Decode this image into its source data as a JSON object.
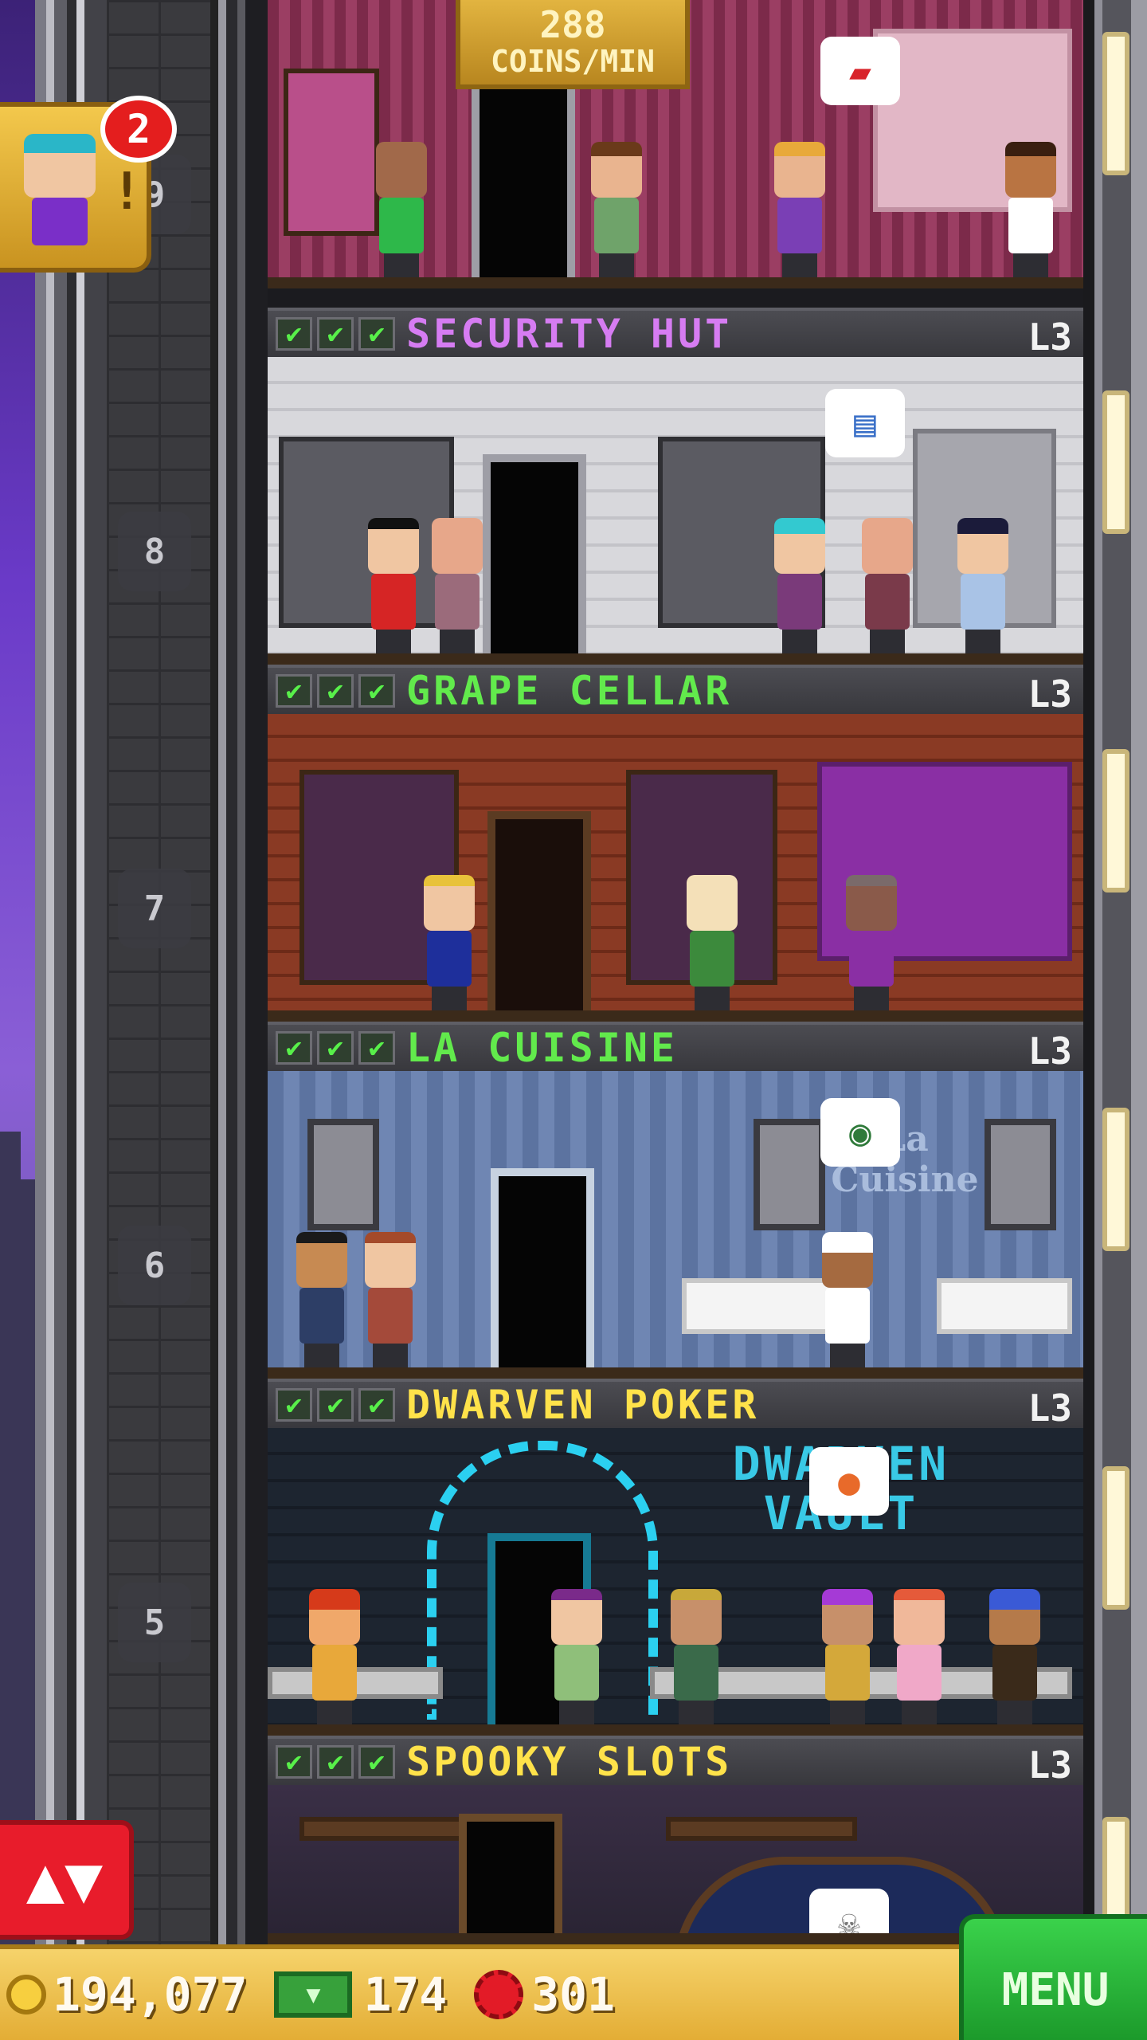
{
  "hud": {
    "coins_per_min_value": "288",
    "coins_per_min_label": "COINS/MIN",
    "coins": "194,077",
    "tower_bux": "174",
    "golden_tickets": "301",
    "menu_label": "MENU",
    "vip_notification_count": "2",
    "vip_alert": "!"
  },
  "elevator": {
    "floor_numbers": [
      "9",
      "8",
      "7",
      "6",
      "5"
    ],
    "button_glyph": "▲▼"
  },
  "floors": [
    {
      "name": "SECURITY HUT",
      "level": "L3",
      "name_color": "#d67cf2",
      "checks": [
        "✔",
        "✔",
        "✔"
      ]
    },
    {
      "name": "GRAPE CELLAR",
      "level": "L3",
      "name_color": "#62ea4c",
      "checks": [
        "✔",
        "✔",
        "✔"
      ]
    },
    {
      "name": "LA CUISINE",
      "level": "L3",
      "name_color": "#62ea4c",
      "checks": [
        "✔",
        "✔",
        "✔"
      ]
    },
    {
      "name": "DWARVEN POKER",
      "level": "L3",
      "name_color": "#ffe24a",
      "checks": [
        "✔",
        "✔",
        "✔"
      ]
    },
    {
      "name": "SPOOKY SLOTS",
      "level": "L3",
      "name_color": "#ffe24a",
      "checks": [
        "✔",
        "✔",
        "✔"
      ]
    }
  ],
  "room_signs": {
    "cuisine_sign": "La Cuisine",
    "dwarven_sign_1": "DWARVEN",
    "dwarven_sign_2": "VAULT"
  },
  "icons": {
    "coin": "coin-icon",
    "cash": "cash-icon",
    "bux": "tower-bux-icon",
    "elevator": "elevator-arrows-icon"
  }
}
